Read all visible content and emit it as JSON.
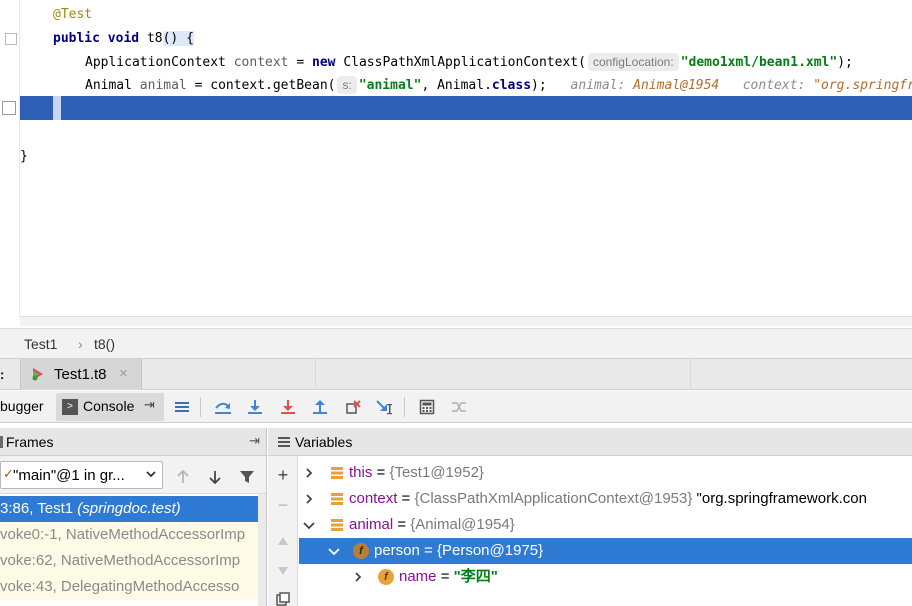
{
  "editor": {
    "annotation": "@Test",
    "method_kw_public": "public",
    "method_kw_void": "void",
    "method_name": "t8",
    "method_open": "() {",
    "line3": {
      "type": "ApplicationContext",
      "ident": "context",
      "eq": " = ",
      "new_kw": "new",
      "ctor": "ClassPathXmlApplicationContext(",
      "hint": "configLocation:",
      "arg": "\"demo1xml/bean1.xml\"",
      "end": ");"
    },
    "line4": {
      "type": "Animal",
      "ident": "animal",
      "mid": " = context.getBean(",
      "hint": "s:",
      "arg": "\"animal\"",
      "rest_a": ", Animal.",
      "class_kw": "class",
      "end": ");",
      "inline_label1": "animal:",
      "inline_value1": "Animal@1954",
      "inline_label2": "context:",
      "inline_value2": "\"org.springfr"
    },
    "closing_brace": "}"
  },
  "breadcrumb": {
    "items": [
      "Test1",
      "t8()"
    ],
    "separator": "›"
  },
  "debug_tabs": {
    "prefix": ":",
    "session_tab": "Test1.t8",
    "close": "×"
  },
  "toolbar": {
    "debugger_label": "bugger",
    "console_label": "Console",
    "console_pin": "⇥"
  },
  "frames": {
    "title": "Frames",
    "pin": "⇥",
    "thread_check": "✓",
    "thread_label": "\"main\"@1 in gr...",
    "items": [
      {
        "text_a": "3:86, Test1 ",
        "pkg": "(springdoc.test)"
      },
      {
        "text_a": "voke0:-1, NativeMethodAccessorImp",
        "pkg": ""
      },
      {
        "text_a": "voke:62, NativeMethodAccessorImp",
        "pkg": ""
      },
      {
        "text_a": "voke:43, DelegatingMethodAccesso",
        "pkg": ""
      }
    ]
  },
  "variables": {
    "title": "Variables",
    "rows": [
      {
        "name": "this",
        "eq": " = ",
        "type": "{Test1@1952}",
        "extra": ""
      },
      {
        "name": "context",
        "eq": " = ",
        "type": "{ClassPathXmlApplicationContext@1953}",
        "extra": " \"org.springframework.con"
      },
      {
        "name": "animal",
        "eq": " = ",
        "type": "{Animal@1954}",
        "extra": ""
      },
      {
        "name": "person",
        "eq": " = ",
        "type": "{Person@1975}",
        "extra": ""
      },
      {
        "name": "name",
        "eq": " = ",
        "type": "",
        "extra": "\"李四\""
      }
    ],
    "field_badge": "f"
  },
  "colors": {
    "selection": "#2f7bd3",
    "current_line": "#2d5fb6",
    "keyword": "#000080",
    "string": "#067d17",
    "variable_name": "#871094"
  }
}
